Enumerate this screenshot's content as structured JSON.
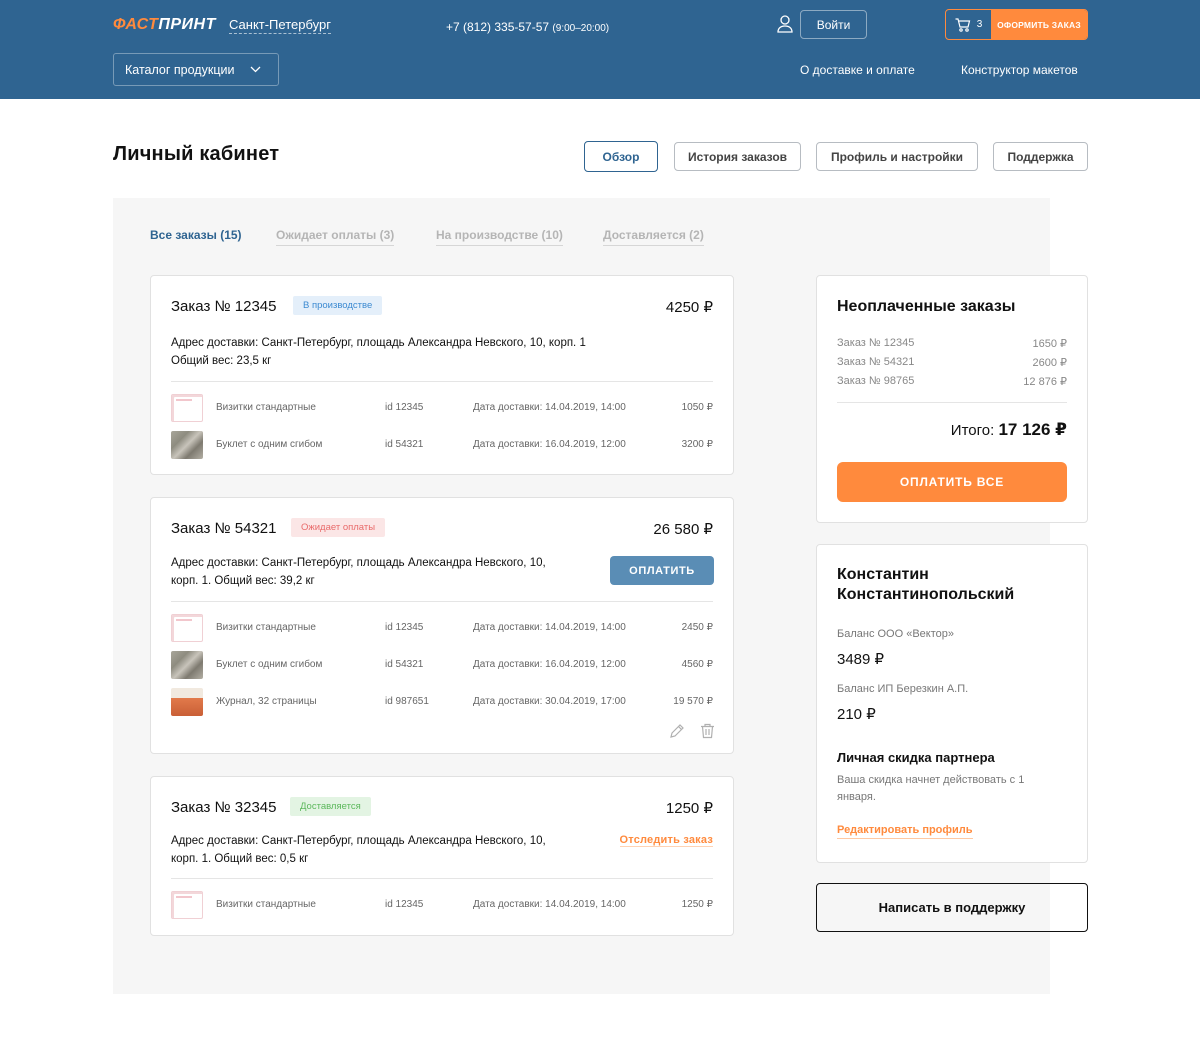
{
  "header": {
    "logo_part1": "ФАСТ",
    "logo_part2": "ПРИНТ",
    "city": "Санкт-Петербург",
    "phone": "+7 (812) 335-57-57",
    "phone_hours": "(9:00–20:00)",
    "login_label": "Войти",
    "cart_count": "3",
    "checkout_label": "ОФОРМИТЬ ЗАКАЗ",
    "catalog_label": "Каталог продукции",
    "nav": [
      "О доставке и оплате",
      "Конструктор макетов"
    ]
  },
  "page": {
    "title": "Личный кабинет",
    "tabs": [
      "Обзор",
      "История заказов",
      "Профиль и настройки",
      "Поддержка"
    ]
  },
  "filters": [
    "Все заказы (15)",
    "Ожидает оплаты (3)",
    "На производстве (10)",
    "Доставляется (2)"
  ],
  "orders": [
    {
      "title": "Заказ № 12345",
      "status": "В производстве",
      "sum": "4250 ₽",
      "address_1": "Адрес доставки: Санкт-Петербург, площадь Александра Невского, 10, корп. 1",
      "address_2": "Общий вес: 23,5 кг",
      "items": [
        {
          "name": "Визитки стандартные",
          "id": "id 12345",
          "date": "Дата доставки: 14.04.2019, 14:00",
          "price": "1050 ₽"
        },
        {
          "name": "Буклет с одним сгибом",
          "id": "id 54321",
          "date": "Дата доставки: 16.04.2019, 12:00",
          "price": "3200 ₽"
        }
      ]
    },
    {
      "title": "Заказ № 54321",
      "status": "Ожидает оплаты",
      "sum": "26 580 ₽",
      "address_1": "Адрес доставки: Санкт-Петербург, площадь Александра Невского, 10,",
      "address_2": "корп. 1. Общий вес: 39,2 кг",
      "action": "ОПЛАТИТЬ",
      "items": [
        {
          "name": "Визитки стандартные",
          "id": "id 12345",
          "date": "Дата доставки: 14.04.2019, 14:00",
          "price": "2450 ₽"
        },
        {
          "name": "Буклет с одним сгибом",
          "id": "id 54321",
          "date": "Дата доставки: 16.04.2019, 12:00",
          "price": "4560 ₽"
        },
        {
          "name": "Журнал, 32 страницы",
          "id": "id 987651",
          "date": "Дата доставки: 30.04.2019, 17:00",
          "price": "19 570 ₽"
        }
      ]
    },
    {
      "title": "Заказ № 32345",
      "status": "Доставляется",
      "sum": "1250 ₽",
      "address_1": "Адрес доставки: Санкт-Петербург, площадь Александра Невского, 10,",
      "address_2": "корп. 1. Общий вес: 0,5 кг",
      "action": "Отследить заказ",
      "items": [
        {
          "name": "Визитки стандартные",
          "id": "id 12345",
          "date": "Дата доставки: 14.04.2019, 14:00",
          "price": "1250 ₽"
        }
      ]
    }
  ],
  "unpaid": {
    "title": "Неоплаченные заказы",
    "rows": [
      {
        "label": "Заказ № 12345",
        "value": "1650 ₽"
      },
      {
        "label": "Заказ № 54321",
        "value": "2600 ₽"
      },
      {
        "label": "Заказ № 98765",
        "value": "12 876 ₽"
      }
    ],
    "total_label": "Итого:",
    "total_value": "17 126 ₽",
    "pay_all": "ОПЛАТИТЬ ВСЕ"
  },
  "profile": {
    "name_1": "Константин",
    "name_2": "Константинопольский",
    "balance_1_label": "Баланс ООО «Вектор»",
    "balance_1_value": "3489 ₽",
    "balance_2_label": "Баланс ИП Березкин А.П.",
    "balance_2_value": "210 ₽",
    "discount_title": "Личная скидка партнера",
    "discount_text": "Ваша скидка начнет действовать с 1 января.",
    "edit_link": "Редактировать профиль"
  },
  "support_label": "Написать в поддержку",
  "colors": {
    "primary": "#2f6491",
    "accent": "#ff8a3d",
    "panel": "#f6f6f6"
  }
}
